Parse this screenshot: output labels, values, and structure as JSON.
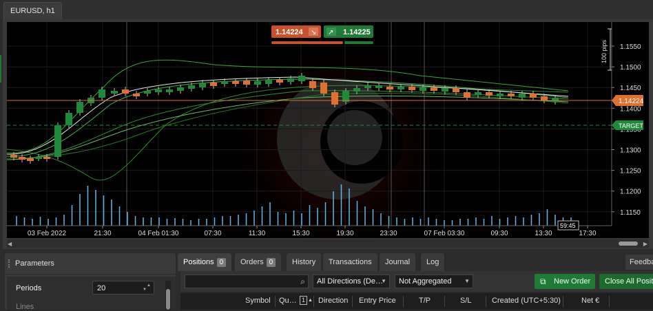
{
  "tab": {
    "title": "EURUSD, h1"
  },
  "trade": {
    "sell_price": "1.14224",
    "buy_price": "1.14225",
    "sell_color": "#c8502a",
    "buy_color": "#1f7a36"
  },
  "chart": {
    "price_labels": [
      "1.1550",
      "1.1500",
      "1.1450",
      "1.1400",
      "1.1350",
      "1.1300",
      "1.1250",
      "1.1200",
      "1.1150"
    ],
    "time_labels": [
      "03 Feb 2022",
      "21:30",
      "04 Feb 01:30",
      "07:30",
      "11:30",
      "15:30",
      "19:30",
      "23:30",
      "07 Feb 03:30",
      "09:30",
      "13:30",
      "17:30"
    ],
    "current_price_tag": "1.14224",
    "target_tag": "TARGET",
    "pips_label": "100 pips",
    "countdown": "59:45",
    "current_price_color": "#e07030",
    "target_color": "#1f8a3a"
  },
  "parameters": {
    "title": "Parameters",
    "periods_label": "Periods",
    "periods_value": "20",
    "lines_label": "Lines"
  },
  "bottom_tabs": {
    "positions": "Positions",
    "positions_count": "0",
    "orders": "Orders",
    "orders_count": "0",
    "history": "History",
    "transactions": "Transactions",
    "journal": "Journal",
    "log": "Log",
    "feedback": "Feedba"
  },
  "toolbar": {
    "search_placeholder": "",
    "directions": "All Directions (De…",
    "aggregation": "Not Aggregated",
    "new_order": "New Order",
    "close_all": "Close All Positi"
  },
  "table_headers": [
    "Symbol",
    "Qu…",
    "Direction",
    "Entry Price",
    "T/P",
    "S/L",
    "Created (UTC+5:30)",
    "Net €"
  ],
  "qty_badge": "1"
}
